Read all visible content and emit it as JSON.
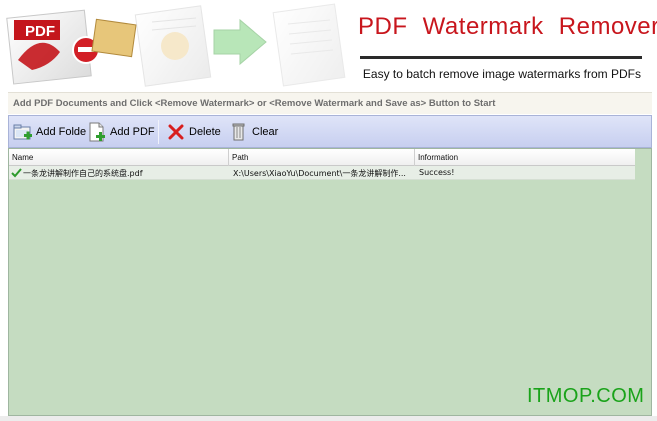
{
  "banner": {
    "logo_text": "PDF",
    "title": "PDF  Watermark  Remover",
    "subtitle": "Easy to batch remove image watermarks from PDFs"
  },
  "instruction": {
    "text": "Add PDF Documents and Click <Remove Watermark> or <Remove Watermark and Save as> Button to Start"
  },
  "toolbar": {
    "add_folder_label": "Add Folde",
    "add_pdf_label": "Add PDF",
    "delete_label": "Delete",
    "clear_label": "Clear"
  },
  "list": {
    "columns": [
      "Name",
      "Path",
      "Information"
    ],
    "rows": [
      {
        "name": "一条龙讲解制作自己的系统盘.pdf",
        "path": "X:\\Users\\XiaoYu\\Document\\一条龙讲解制作...",
        "info": "Success!"
      }
    ]
  },
  "watermark": {
    "text": "ITMOP.COM"
  },
  "colors": {
    "title_red": "#c8161d",
    "list_bg": "#c5dcc1",
    "toolbar_bg": "#c7cff0",
    "watermark_green": "#1aa31a"
  }
}
